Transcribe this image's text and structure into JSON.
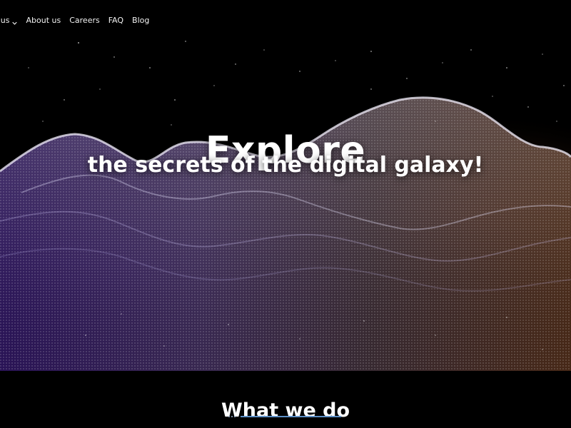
{
  "nav": {
    "items": [
      {
        "label": "ut us",
        "has_dropdown": true,
        "icon": "chevron-down-icon"
      },
      {
        "label": "About us",
        "has_dropdown": false
      },
      {
        "label": "Careers",
        "has_dropdown": false
      },
      {
        "label": "FAQ",
        "has_dropdown": false
      },
      {
        "label": "Blog",
        "has_dropdown": false
      }
    ]
  },
  "hero": {
    "title": "Explore",
    "subtitle": "the secrets of the digital galaxy!",
    "colors": {
      "background": "#000000",
      "wave_purple": "#7b4cff",
      "wave_orange": "#d9803a",
      "wave_white": "#f0ecff"
    }
  },
  "what_we_do": {
    "title": "What we do",
    "divider_color": "#5d8fc6"
  }
}
